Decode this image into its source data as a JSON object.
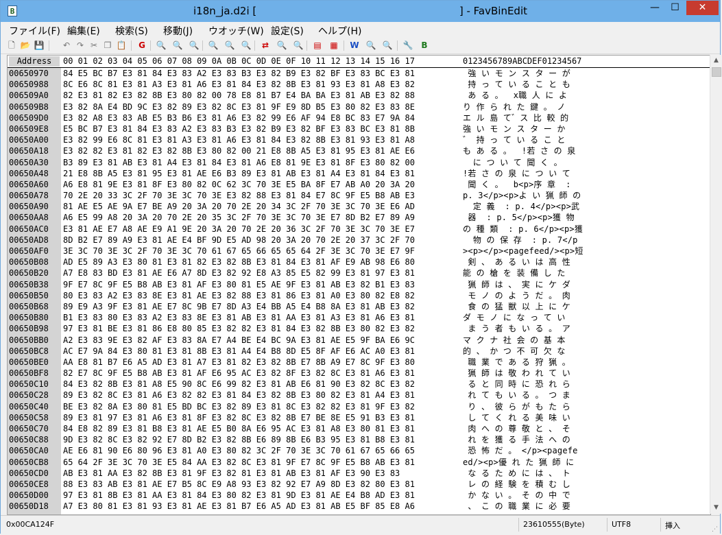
{
  "window": {
    "title": "i18n_ja.d2i [                                                              ] - FavBinEdit",
    "min_glyph": "—",
    "max_glyph": "☐",
    "close_glyph": "✕",
    "icon_glyph": "B"
  },
  "menu": [
    "ファイル(F)",
    "編集(E)",
    "検索(S)",
    "移動(J)",
    "ウオッチ(W)",
    "設定(S)",
    "ヘルプ(H)"
  ],
  "toolbar": [
    {
      "name": "new-file-icon",
      "glyph": "🗋",
      "cls": ""
    },
    {
      "name": "open-folder-icon",
      "glyph": "📂",
      "cls": ""
    },
    {
      "name": "save-icon",
      "glyph": "💾",
      "cls": "gray"
    },
    {
      "name": "undo-icon",
      "glyph": "↶",
      "cls": "gray"
    },
    {
      "name": "redo-icon",
      "glyph": "↷",
      "cls": "gray"
    },
    {
      "name": "cut-icon",
      "glyph": "✂",
      "cls": "gray"
    },
    {
      "name": "copy-icon",
      "glyph": "❐",
      "cls": "gray"
    },
    {
      "name": "paste-icon",
      "glyph": "📋",
      "cls": "gray"
    },
    {
      "name": "goto-icon",
      "glyph": "G",
      "cls": "red"
    },
    {
      "name": "search-icon",
      "glyph": "🔍",
      "cls": ""
    },
    {
      "name": "search-next-icon",
      "glyph": "🔍",
      "cls": "gray"
    },
    {
      "name": "search-prev-icon",
      "glyph": "🔍",
      "cls": "gray"
    },
    {
      "name": "search-hex-icon",
      "glyph": "🔍",
      "cls": "red"
    },
    {
      "name": "search-binary-icon",
      "glyph": "🔍",
      "cls": "gray"
    },
    {
      "name": "search-all-icon",
      "glyph": "🔍",
      "cls": "gray"
    },
    {
      "name": "replace-icon",
      "glyph": "⇄",
      "cls": "red"
    },
    {
      "name": "replace-next-icon",
      "glyph": "🔍",
      "cls": "gray"
    },
    {
      "name": "replace-all-icon",
      "glyph": "🔍",
      "cls": "gray"
    },
    {
      "name": "bookmark-icon",
      "glyph": "▤",
      "cls": "red"
    },
    {
      "name": "bookmark-list-icon",
      "glyph": "▦",
      "cls": "red"
    },
    {
      "name": "watch-icon",
      "glyph": "W",
      "cls": "blue"
    },
    {
      "name": "watch-search-icon",
      "glyph": "🔍",
      "cls": "gray"
    },
    {
      "name": "watch-clear-icon",
      "glyph": "🔍",
      "cls": "gray"
    },
    {
      "name": "settings-icon",
      "glyph": "🔧",
      "cls": "blue"
    },
    {
      "name": "about-icon",
      "glyph": "B",
      "cls": "green"
    }
  ],
  "header": {
    "address": "Address",
    "hex_cols": "00 01 02 03 04 05 06 07 08 09 0A 0B 0C 0D 0E 0F 10 11 12 13 14 15 16 17",
    "text_cols": "0123456789ABCDEF01234567"
  },
  "rows": [
    {
      "addr": "00650970",
      "hex": "84 E5 BC B7 E3 81 84 E3 83 A2 E3 83 B3 E3 82 B9 E3 82 BF E3 83 BC E3 81",
      "text": " 強 い モ ン ス タ ー が"
    },
    {
      "addr": "00650988",
      "hex": "8C E6 8C 81 E3 81 A3 E3 81 A6 E3 81 84 E3 82 8B E3 81 93 E3 81 A8 E3 82",
      "text": " 持 っ て い る こ と も"
    },
    {
      "addr": "006509A0",
      "hex": "82 E3 81 82 E3 82 8B E3 80 82 00 78 E8 81 B7 E4 BA BA E3 81 AB E3 82 88",
      "text": " あ る 。  x職 人 に よ"
    },
    {
      "addr": "006509B8",
      "hex": "E3 82 8A E4 BD 9C E3 82 89 E3 82 8C E3 81 9F E9 8D B5 E3 80 82 E3 83 8E",
      "text": "り 作 ら れ た 鍵 。 ノ"
    },
    {
      "addr": "006509D0",
      "hex": "E3 82 A8 E3 83 AB E5 B3 B6 E3 81 A6 E3 82 99 E6 AF 94 E8 BC 83 E7 9A 84",
      "text": "エ ル 島 て゛ス 比 較 的"
    },
    {
      "addr": "006509E8",
      "hex": "E5 BC B7 E3 81 84 E3 83 A2 E3 83 B3 E3 82 B9 E3 82 BF E3 83 BC E3 81 8B",
      "text": "強 い モ ン ス タ ー か"
    },
    {
      "addr": "00650A00",
      "hex": "E3 82 99 E6 8C 81 E3 81 A3 E3 81 A6 E3 81 84 E3 82 8B E3 81 93 E3 81 A8",
      "text": "゛ 持 っ て い る こ と"
    },
    {
      "addr": "00650A18",
      "hex": "E3 82 82 E3 81 82 E3 82 8B E3 80 82 00 21 E8 8B A5 E3 81 95 E3 81 AE E6",
      "text": "も あ る 。  !若 さ の 泉"
    },
    {
      "addr": "00650A30",
      "hex": "B3 89 E3 81 AB E3 81 A4 E3 81 84 E3 81 A6 E8 81 9E E3 81 8F E3 80 82 00",
      "text": "  に つ い て 聞 く 。"
    },
    {
      "addr": "00650A48",
      "hex": "21 E8 8B A5 E3 81 95 E3 81 AE E6 B3 89 E3 81 AB E3 81 A4 E3 81 84 E3 81",
      "text": "!若 さ の 泉 に つ い て"
    },
    {
      "addr": "00650A60",
      "hex": "A6 E8 81 9E E3 81 8F E3 80 82 0C 62 3C 70 3E E5 BA 8F E7 AB A0 20 3A 20",
      "text": " 聞 く 。  b<p>序 章  :"
    },
    {
      "addr": "00650A78",
      "hex": "70 2E 20 33 3C 2F 70 3E 3C 70 3E E3 82 88 E3 81 84 E7 8C 9F E5 B8 AB E3",
      "text": "p. 3</p><p>よ い 猟 師 の"
    },
    {
      "addr": "00650A90",
      "hex": "81 AE E5 AE 9A E7 BE A9 20 3A 20 70 2E 20 34 3C 2F 70 3E 3C 70 3E E6 AD",
      "text": "  定 義  : p. 4</p><p>武"
    },
    {
      "addr": "00650AA8",
      "hex": "A6 E5 99 A8 20 3A 20 70 2E 20 35 3C 2F 70 3E 3C 70 3E E7 8D B2 E7 89 A9",
      "text": " 器  : p. 5</p><p>獲 物"
    },
    {
      "addr": "00650AC0",
      "hex": "E3 81 AE E7 A8 AE E9 A1 9E 20 3A 20 70 2E 20 36 3C 2F 70 3E 3C 70 3E E7",
      "text": "の 種 類  : p. 6</p><p>獲"
    },
    {
      "addr": "00650AD8",
      "hex": "8D B2 E7 89 A9 E3 81 AE E4 BF 9D E5 AD 98 20 3A 20 70 2E 20 37 3C 2F 70",
      "text": "  物 の 保 存  : p. 7</p"
    },
    {
      "addr": "00650AF0",
      "hex": "3E 3C 70 3E 3C 2F 70 3E 3C 70 61 67 65 66 65 65 64 2F 3E 3C 70 3E E7 9F",
      "text": "><p></p><pagefeed/><p>短"
    },
    {
      "addr": "00650B08",
      "hex": "AD E5 89 A3 E3 80 81 E3 81 82 E3 82 8B E3 81 84 E3 81 AF E9 AB 98 E6 80",
      "text": " 剣 、 あ る い は 高 性"
    },
    {
      "addr": "00650B20",
      "hex": "A7 E8 83 BD E3 81 AE E6 A7 8D E3 82 92 E8 A3 85 E5 82 99 E3 81 97 E3 81",
      "text": "能 の 槍 を 装 備 し た"
    },
    {
      "addr": "00650B38",
      "hex": "9F E7 8C 9F E5 B8 AB E3 81 AF E3 80 81 E5 AE 9F E3 81 AB E3 82 B1 E3 83",
      "text": " 猟 師 は 、 実 に ケ ダ"
    },
    {
      "addr": "00650B50",
      "hex": "80 E3 83 A2 E3 83 8E E3 81 AE E3 82 88 E3 81 86 E3 81 A0 E3 80 82 E8 82",
      "text": " モ ノ の よ う だ 。 肉"
    },
    {
      "addr": "00650B68",
      "hex": "89 E9 A3 9F E3 81 AE E7 8C 9B E7 8D A3 E4 BB A5 E4 B8 8A E3 81 AB E3 82",
      "text": " 食 の 猛 獣 以 上 に ケ"
    },
    {
      "addr": "00650B80",
      "hex": "B1 E3 83 80 E3 83 A2 E3 83 8E E3 81 AB E3 81 AA E3 81 A3 E3 81 A6 E3 81",
      "text": "ダ モ ノ に な っ て い"
    },
    {
      "addr": "00650B98",
      "hex": "97 E3 81 BE E3 81 86 E8 80 85 E3 82 82 E3 81 84 E3 82 8B E3 80 82 E3 82",
      "text": " ま う 者 も い る 。 ア"
    },
    {
      "addr": "00650BB0",
      "hex": "A2 E3 83 9E E3 82 AF E3 83 8A E7 A4 BE E4 BC 9A E3 81 AE E5 9F BA E6 9C",
      "text": "マ ク ナ 社 会 の 基 本"
    },
    {
      "addr": "00650BC8",
      "hex": "AC E7 9A 84 E3 80 81 E3 81 8B E3 81 A4 E4 B8 8D E5 8F AF E6 AC A0 E3 81",
      "text": "的 、 か つ 不 可 欠 な"
    },
    {
      "addr": "00650BE0",
      "hex": "AA E8 81 B7 E6 A5 AD E3 81 A7 E3 81 82 E3 82 8B E7 8B A9 E7 8C 9F E3 80",
      "text": " 職 業 で あ る 狩 猟 。"
    },
    {
      "addr": "00650BF8",
      "hex": "82 E7 8C 9F E5 B8 AB E3 81 AF E6 95 AC E3 82 8F E3 82 8C E3 81 A6 E3 81",
      "text": " 猟 師 は 敬 わ れ て い"
    },
    {
      "addr": "00650C10",
      "hex": "84 E3 82 8B E3 81 A8 E5 90 8C E6 99 82 E3 81 AB E6 81 90 E3 82 8C E3 82",
      "text": " る と 同 時 に 恐 れ ら"
    },
    {
      "addr": "00650C28",
      "hex": "89 E3 82 8C E3 81 A6 E3 82 82 E3 81 84 E3 82 8B E3 80 82 E3 81 A4 E3 81",
      "text": " れ て も い る 。 つ ま"
    },
    {
      "addr": "00650C40",
      "hex": "BE E3 82 8A E3 80 81 E5 BD BC E3 82 89 E3 81 8C E3 82 82 E3 81 9F E3 82",
      "text": " り 、 彼 ら が も た ら"
    },
    {
      "addr": "00650C58",
      "hex": "89 E3 81 97 E3 81 A6 E3 81 8F E3 82 8C E3 82 8B E7 BE 8E E5 91 B3 E3 81",
      "text": " し て く れ る 美 味 い"
    },
    {
      "addr": "00650C70",
      "hex": "84 E8 82 89 E3 81 B8 E3 81 AE E5 B0 8A E6 95 AC E3 81 A8 E3 80 81 E3 81",
      "text": " 肉 へ の 尊 敬 と 、 そ"
    },
    {
      "addr": "00650C88",
      "hex": "9D E3 82 8C E3 82 92 E7 8D B2 E3 82 8B E6 89 8B E6 B3 95 E3 81 B8 E3 81",
      "text": " れ を 獲 る 手 法 へ の"
    },
    {
      "addr": "00650CA0",
      "hex": "AE E6 81 90 E6 80 96 E3 81 A0 E3 80 82 3C 2F 70 3E 3C 70 61 67 65 66 65",
      "text": " 恐 怖 だ 。 </p><pagefe"
    },
    {
      "addr": "00650CB8",
      "hex": "65 64 2F 3E 3C 70 3E E5 84 AA E3 82 8C E3 81 9F E7 8C 9F E5 B8 AB E3 81",
      "text": "ed/><p>優 れ た 猟 師 に"
    },
    {
      "addr": "00650CD0",
      "hex": "AB E3 81 AA E3 82 8B E3 81 9F E3 82 81 E3 81 AB E3 81 AF E3 90 E3 83",
      "text": " な る た め に は 、 ト"
    },
    {
      "addr": "00650CE8",
      "hex": "88 E3 83 AB E3 81 AE E7 B5 8C E9 A8 93 E3 82 92 E7 A9 8D E3 82 80 E3 81",
      "text": " レ の 経 験 を 積 む し"
    },
    {
      "addr": "00650D00",
      "hex": "97 E3 81 8B E3 81 AA E3 81 84 E3 80 82 E3 81 9D E3 81 AE E4 B8 AD E3 81",
      "text": " か な い 。 そ の 中 で"
    },
    {
      "addr": "00650D18",
      "hex": "A7 E3 80 81 E3 81 93 E3 81 AE E3 81 B7 E6 A5 AD E3 81 AB E5 BF 85 E8 A6",
      "text": " 、 こ の 職 業 に 必 要"
    }
  ],
  "status": {
    "position": "0x00CA124F",
    "size": "23610555(Byte)",
    "encoding": "UTF8",
    "mode": "挿入"
  }
}
